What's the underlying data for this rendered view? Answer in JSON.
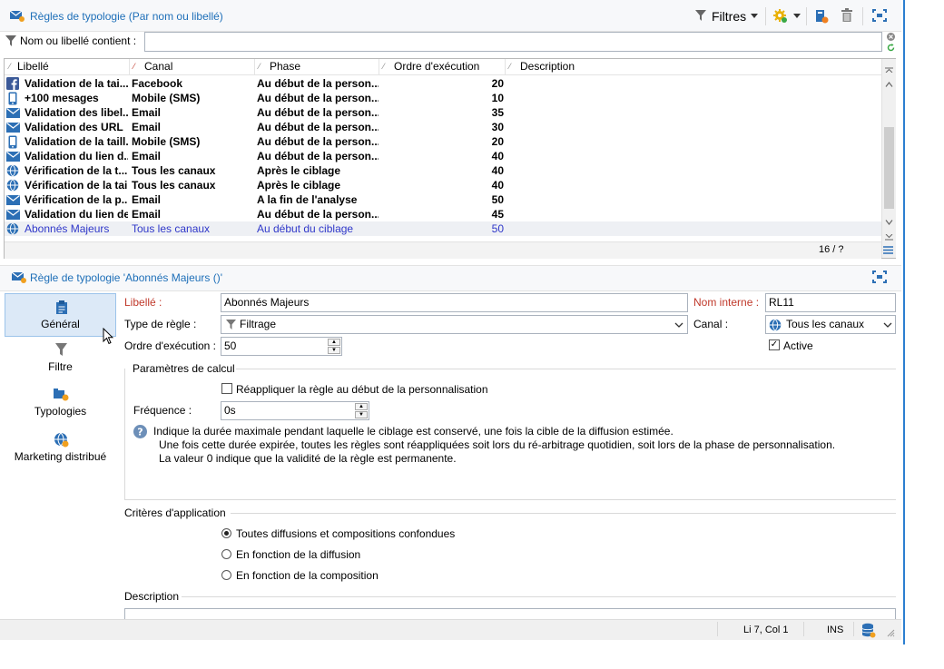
{
  "top": {
    "title": "Règles de typologie (Par nom ou libellé)",
    "filters_label": "Filtres",
    "filter_label": "Nom ou libellé contient :",
    "filter_value": ""
  },
  "list": {
    "columns": [
      "Libellé",
      "Canal",
      "Phase",
      "Ordre d'exécution",
      "Description"
    ],
    "rows": [
      {
        "icon": "facebook-icon",
        "label": "Validation de la tai...",
        "channel": "Facebook",
        "phase": "Au début de la person...",
        "order": "20",
        "desc": ""
      },
      {
        "icon": "mobile-icon",
        "label": "+100 mesages",
        "channel": "Mobile (SMS)",
        "phase": "Au début de la person...",
        "order": "10",
        "desc": ""
      },
      {
        "icon": "email-icon",
        "label": "Validation des libel...",
        "channel": "Email",
        "phase": "Au début de la person...",
        "order": "35",
        "desc": ""
      },
      {
        "icon": "email-icon",
        "label": "Validation des URL",
        "channel": "Email",
        "phase": "Au début de la person...",
        "order": "30",
        "desc": ""
      },
      {
        "icon": "mobile-icon",
        "label": "Validation de la taill...",
        "channel": "Mobile (SMS)",
        "phase": "Au début de la person...",
        "order": "20",
        "desc": ""
      },
      {
        "icon": "email-icon",
        "label": "Validation du lien d...",
        "channel": "Email",
        "phase": "Au début de la person...",
        "order": "40",
        "desc": ""
      },
      {
        "icon": "globe-icon",
        "label": "Vérification de la t...",
        "channel": "Tous les canaux",
        "phase": "Après le ciblage",
        "order": "40",
        "desc": ""
      },
      {
        "icon": "globe-icon",
        "label": "Vérification de la tai...",
        "channel": "Tous les canaux",
        "phase": "Après le ciblage",
        "order": "40",
        "desc": ""
      },
      {
        "icon": "email-icon",
        "label": "Vérification de la p...",
        "channel": "Email",
        "phase": "A la fin de l'analyse",
        "order": "50",
        "desc": ""
      },
      {
        "icon": "email-icon",
        "label": "Validation du lien de",
        "channel": "Email",
        "phase": "Au début de la person...",
        "order": "45",
        "desc": ""
      },
      {
        "icon": "globe-icon",
        "label": "Abonnés Majeurs",
        "channel": "Tous les canaux",
        "phase": "Au début du ciblage",
        "order": "50",
        "desc": "",
        "selected": true
      }
    ],
    "count": "16 / ?"
  },
  "detail": {
    "title": "Règle de typologie 'Abonnés Majeurs ()'",
    "tabs": [
      "Général",
      "Filtre",
      "Typologies",
      "Marketing distribué"
    ],
    "label_caption": "Libellé :",
    "label_value": "Abonnés Majeurs",
    "internal_caption": "Nom interne :",
    "internal_value": "RL11",
    "type_caption": "Type de règle :",
    "type_value": "Filtrage",
    "channel_caption": "Canal :",
    "channel_value": "Tous les canaux",
    "order_caption": "Ordre d'exécution :",
    "order_value": "50",
    "active_label": "Active",
    "calc_group": "Paramètres de calcul",
    "reapply_label": "Réappliquer la règle au début de la personnalisation",
    "freq_caption": "Fréquence :",
    "freq_value": "0s",
    "info_line1": "Indique la durée maximale pendant laquelle le ciblage est conservé, une fois la cible de la diffusion estimée.",
    "info_line2": "Une fois cette durée expirée, toutes les règles sont réappliquées soit lors du ré-arbitrage quotidien, soit lors de la phase de personnalisation.",
    "info_line3": "La valeur 0 indique que la validité de la règle est permanente.",
    "criteria_group": "Critères d'application",
    "radio1": "Toutes diffusions et compositions confondues",
    "radio2": "En fonction de la diffusion",
    "radio3": "En fonction de la composition",
    "description_group": "Description"
  },
  "status": {
    "position": "Li 7, Col 1",
    "mode": "INS"
  },
  "colors": {
    "accent": "#1e6fb8",
    "selected_text": "#2f37c9",
    "required": "#c0392b"
  }
}
